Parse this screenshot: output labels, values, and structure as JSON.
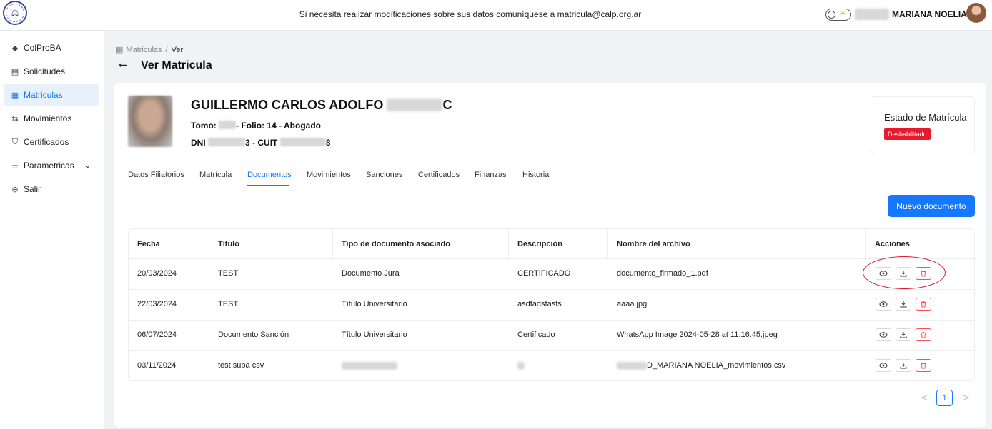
{
  "header": {
    "notice": "Si necesita realizar modificaciones sobre sus datos comuníquese a matricula@calp.org.ar",
    "user_name": "MARIANA NOELIA",
    "logo_icon": "institution-seal-icon",
    "theme_toggle_icon": "sun-icon"
  },
  "sidebar": {
    "items": [
      {
        "label": "ColProBA",
        "icon": "pin-icon"
      },
      {
        "label": "Solicitudes",
        "icon": "document-icon"
      },
      {
        "label": "Matriculas",
        "icon": "list-document-icon"
      },
      {
        "label": "Movimientos",
        "icon": "swap-icon"
      },
      {
        "label": "Certificados",
        "icon": "shield-icon"
      },
      {
        "label": "Parametricas",
        "icon": "list-icon"
      },
      {
        "label": "Salir",
        "icon": "logout-icon"
      }
    ],
    "active_color": "#1677ff"
  },
  "breadcrumb": {
    "parent": "Matriculas",
    "separator": "/",
    "current": "Ver"
  },
  "page": {
    "title": "Ver Matricula"
  },
  "person": {
    "name_start": "GUILLERMO CARLOS ADOLFO",
    "name_end": "C",
    "tomo_label": "Tomo:",
    "folio_text": "- Folio: 14 - Abogado",
    "dni_label": "DNI",
    "dni_tail": "3",
    "cuit_label": "- CUIT",
    "cuit_tail": "8"
  },
  "estado": {
    "label": "Estado de Matrícula",
    "badge": "Deshabilitado",
    "badge_color": "#e8192c"
  },
  "tabs": [
    "Datos Filiatorios",
    "Matrícula",
    "Documentos",
    "Movimientos",
    "Sanciones",
    "Certificados",
    "Finanzas",
    "Historial"
  ],
  "active_tab": "Documentos",
  "new_button": "Nuevo documento",
  "table": {
    "headers": [
      "Fecha",
      "Título",
      "Tipo de documento asociado",
      "Descripción",
      "Nombre del archivo",
      "Acciones"
    ],
    "rows": [
      [
        "20/03/2024",
        "TEST",
        "Documento Jura",
        "CERTIFICADO",
        "documento_firmado_1.pdf"
      ],
      [
        "22/03/2024",
        "TEST",
        "Título Universitario",
        "asdfadsfasfs",
        "aaaa.jpg"
      ],
      [
        "06/07/2024",
        "Documento Sanción",
        "Título Universitario",
        "Certificado",
        "WhatsApp Image 2024-05-28 at 11.16.45.jpeg"
      ],
      [
        "03/11/2024",
        "test suba csv",
        "",
        "",
        "D_MARIANA NOELIA_movimientos.csv"
      ]
    ],
    "action_icons": [
      "eye-icon",
      "download-icon",
      "trash-icon"
    ]
  },
  "pagination": {
    "current_page": "1",
    "prev": "<",
    "next": ">"
  }
}
